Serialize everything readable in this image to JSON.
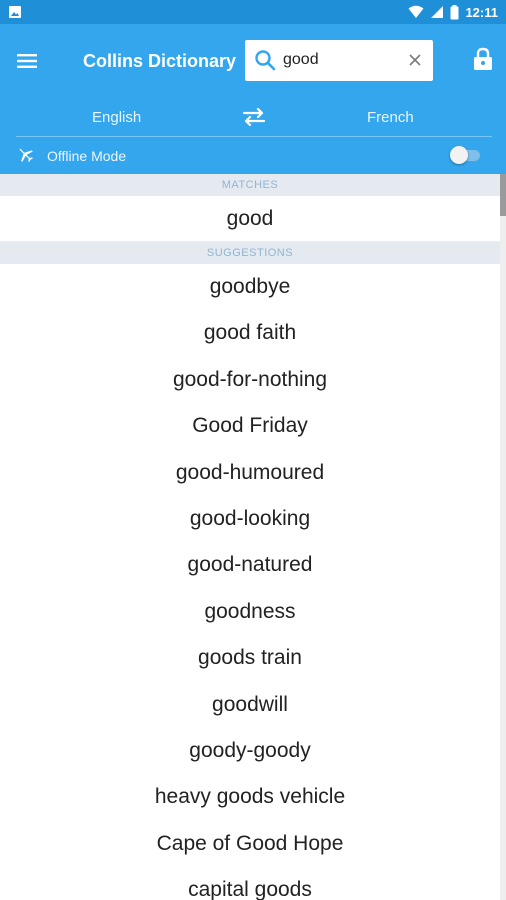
{
  "statusbar": {
    "time": "12:11",
    "icons": [
      "image-icon",
      "wifi-icon",
      "signal-icon",
      "battery-icon"
    ]
  },
  "app": {
    "title": "Collins Dictionary",
    "accent_color": "#33a6ee",
    "status_color": "#1f8fd8"
  },
  "search": {
    "value": "good",
    "placeholder": ""
  },
  "languages": {
    "source": "English",
    "target": "French"
  },
  "offline": {
    "label": "Offline Mode",
    "enabled": false
  },
  "matches": {
    "header": "MATCHES",
    "items": [
      "good"
    ]
  },
  "suggestions": {
    "header": "SUGGESTIONS",
    "items": [
      "goodbye",
      "good faith",
      "good-for-nothing",
      "Good Friday",
      "good-humoured",
      "good-looking",
      "good-natured",
      "goodness",
      "goods train",
      "goodwill",
      "goody-goody",
      "heavy goods vehicle",
      "Cape of Good Hope",
      "capital goods"
    ]
  }
}
